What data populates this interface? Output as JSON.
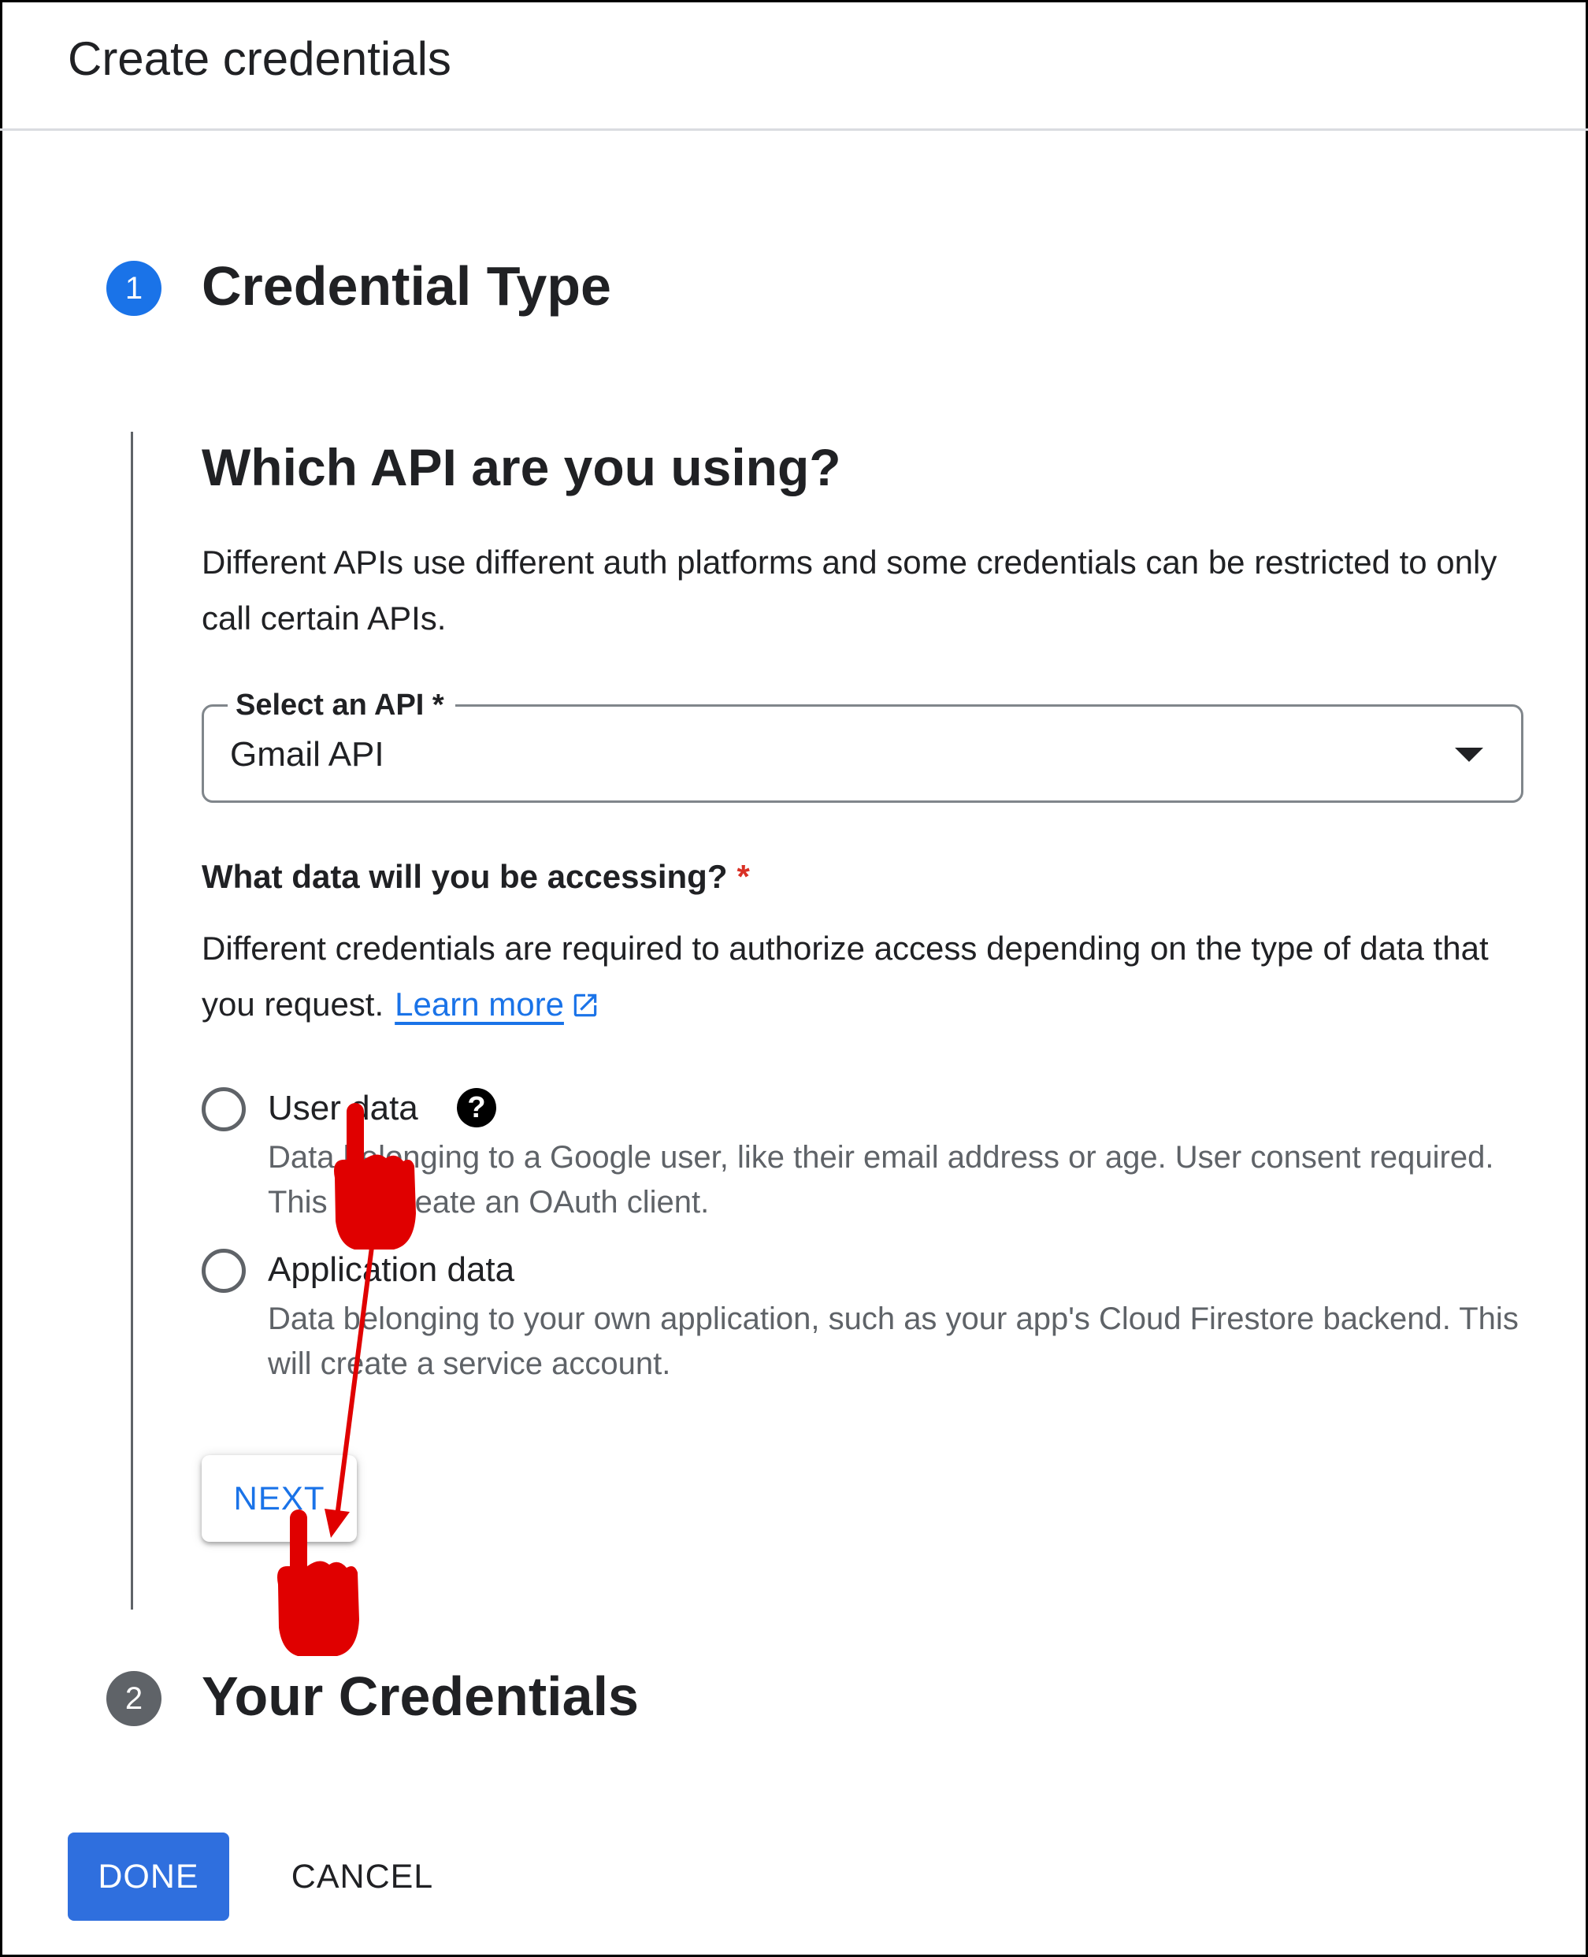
{
  "dialog": {
    "title": "Create credentials"
  },
  "steps": [
    {
      "number": "1",
      "title": "Credential Type"
    },
    {
      "number": "2",
      "title": "Your Credentials"
    }
  ],
  "api_section": {
    "heading": "Which API are you using?",
    "description": "Different APIs use different auth platforms and some credentials can be restricted to only call certain APIs.",
    "select": {
      "label": "Select an API *",
      "value": "Gmail API"
    }
  },
  "data_section": {
    "question": "What data will you be accessing?",
    "required_mark": "*",
    "description": "Different credentials are required to authorize access depending on the type of data that you request.",
    "learn_more": "Learn more",
    "options": [
      {
        "label": "User data",
        "description": "Data belonging to a Google user, like their email address or age. User consent required. This will create an OAuth client.",
        "selected": false
      },
      {
        "label": "Application data",
        "description": "Data belonging to your own application, such as your app's Cloud Firestore backend. This will create a service account.",
        "selected": false
      }
    ]
  },
  "buttons": {
    "next": "NEXT",
    "done": "DONE",
    "cancel": "CANCEL"
  },
  "colors": {
    "primary": "#1a73e8",
    "done_button": "#2f6fde",
    "required": "#d93025",
    "annotation": "#e00000"
  },
  "icons": {
    "help": "help-circle-icon",
    "external": "external-link-icon",
    "dropdown": "caret-down-icon",
    "pointer": "hand-pointer-icon"
  }
}
